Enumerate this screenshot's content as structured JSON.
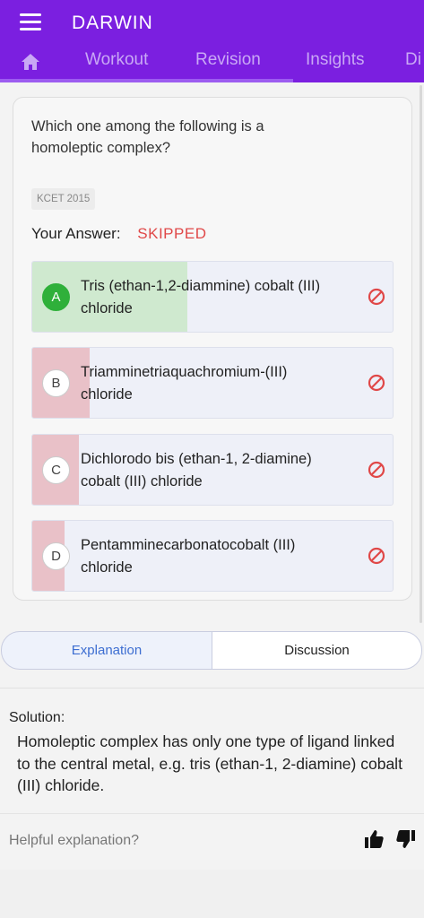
{
  "app": {
    "title": "DARWIN"
  },
  "nav": {
    "tabs": [
      {
        "label": "Workout"
      },
      {
        "label": "Revision"
      },
      {
        "label": "Insights"
      },
      {
        "label": "Di"
      }
    ]
  },
  "question": {
    "text": "Which one among the following is a homoleptic complex?",
    "tag": "KCET 2015",
    "answer_label": "Your Answer:",
    "answer_value": "SKIPPED",
    "options": [
      {
        "letter": "A",
        "text": "Tris (ethan-1,2-diammine) cobalt (III) chloride",
        "status": "correct",
        "fill_pct": 43
      },
      {
        "letter": "B",
        "text": "Triamminetriaquachromium-(III) chloride",
        "status": "wrong",
        "fill_pct": 16
      },
      {
        "letter": "C",
        "text": "Dichlorodo bis (ethan-1, 2-diamine) cobalt (III) chloride",
        "status": "wrong",
        "fill_pct": 13
      },
      {
        "letter": "D",
        "text": "Pentamminecarbonatocobalt (III) chloride",
        "status": "wrong",
        "fill_pct": 9
      }
    ]
  },
  "segments": {
    "explanation": "Explanation",
    "discussion": "Discussion",
    "active": "explanation"
  },
  "solution": {
    "title": "Solution:",
    "text": "Homoleptic complex has only one type of ligand linked to the central metal, e.g. tris (ethan-1, 2-diamine) cobalt (III) chloride.",
    "helpful_prompt": "Helpful explanation?"
  },
  "colors": {
    "header": "#7b1fe0",
    "correct": "#2fb03a",
    "skipped": "#e04848",
    "wrong_fill": "#e9c1c8",
    "correct_fill": "#cfe9cf"
  },
  "icons": {
    "menu": "hamburger-icon",
    "home": "home-icon",
    "skip": "block-icon",
    "like": "thumbs-up-icon",
    "dislike": "thumbs-down-icon"
  }
}
